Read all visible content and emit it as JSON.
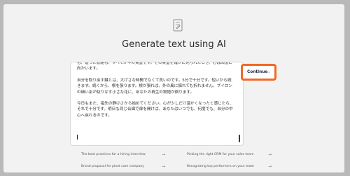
{
  "header": {
    "icon": "document-pen-icon",
    "title": "Generate text using AI"
  },
  "editor": {
    "paragraphs": [
      "も、辿った航路も、すべてが今の貴重です。その貴重を確かに見られたとき、心は回復に向かいます。",
      "自分を取り戻す鍵とは、大げさな時間でなくて良いのです。5分で十分です。短いから続きます。続くから、根を張ります。根が張れば、外の風に揺れても折れません。ブイロンの細い糸が紡りなす小さな花に、あなたの再生の物語が宿ります。",
      "今日もまた、指先の静けさから始めてください。心が少しだけ温かくなったと感じたら、それで十分です。明日も同じ合図で扉を開けば、あなたはいつでも、何度でも、自分の中心へ戻れるのです。"
    ]
  },
  "actions": {
    "continue_label": "Continue",
    "continue_icon": "arrow-right-icon"
  },
  "suggestions": [
    {
      "label": "The best practices for a hiring interview",
      "icon": "arrow-right-icon"
    },
    {
      "label": "Picking the right CRM for your sales team",
      "icon": "arrow-right-icon"
    },
    {
      "label": "Brand proposal for plant care company",
      "icon": "arrow-right-icon"
    },
    {
      "label": "Recognizing top performers on your team",
      "icon": "arrow-right-icon"
    }
  ],
  "colors": {
    "accent_highlight": "#ee6a26",
    "background": "#f2f2f2",
    "frame": "#b9b9b9"
  }
}
